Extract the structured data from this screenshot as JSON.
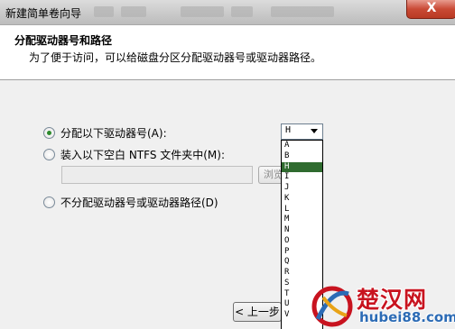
{
  "window": {
    "title": "新建简单卷向导",
    "close_glyph": "X"
  },
  "header": {
    "title": "分配驱动器号和路径",
    "subtitle": "为了便于访问，可以给磁盘分区分配驱动器号或驱动器路径。"
  },
  "options": {
    "assign_letter": {
      "label": "分配以下驱动器号(A):",
      "checked": true
    },
    "mount_ntfs": {
      "label": "装入以下空白 NTFS 文件夹中(M):",
      "checked": false
    },
    "no_assign": {
      "label": "不分配驱动器号或驱动器路径(D)",
      "checked": false
    }
  },
  "drive_select": {
    "value": "H",
    "options": [
      "A",
      "B",
      "H",
      "I",
      "J",
      "K",
      "L",
      "M",
      "N",
      "O",
      "P",
      "Q",
      "R",
      "S",
      "T",
      "U",
      "V"
    ],
    "highlighted": "H"
  },
  "ntfs_path": {
    "value": ""
  },
  "buttons": {
    "browse_label": "浏览",
    "back_label": "< 上一步"
  },
  "watermark": {
    "brand": "楚汉网",
    "url": "hubei88.com"
  },
  "colors": {
    "selection": "#2f6b2f",
    "close_button": "#c94a35",
    "watermark_red": "#c8131f",
    "watermark_blue": "#2c6bb5"
  }
}
